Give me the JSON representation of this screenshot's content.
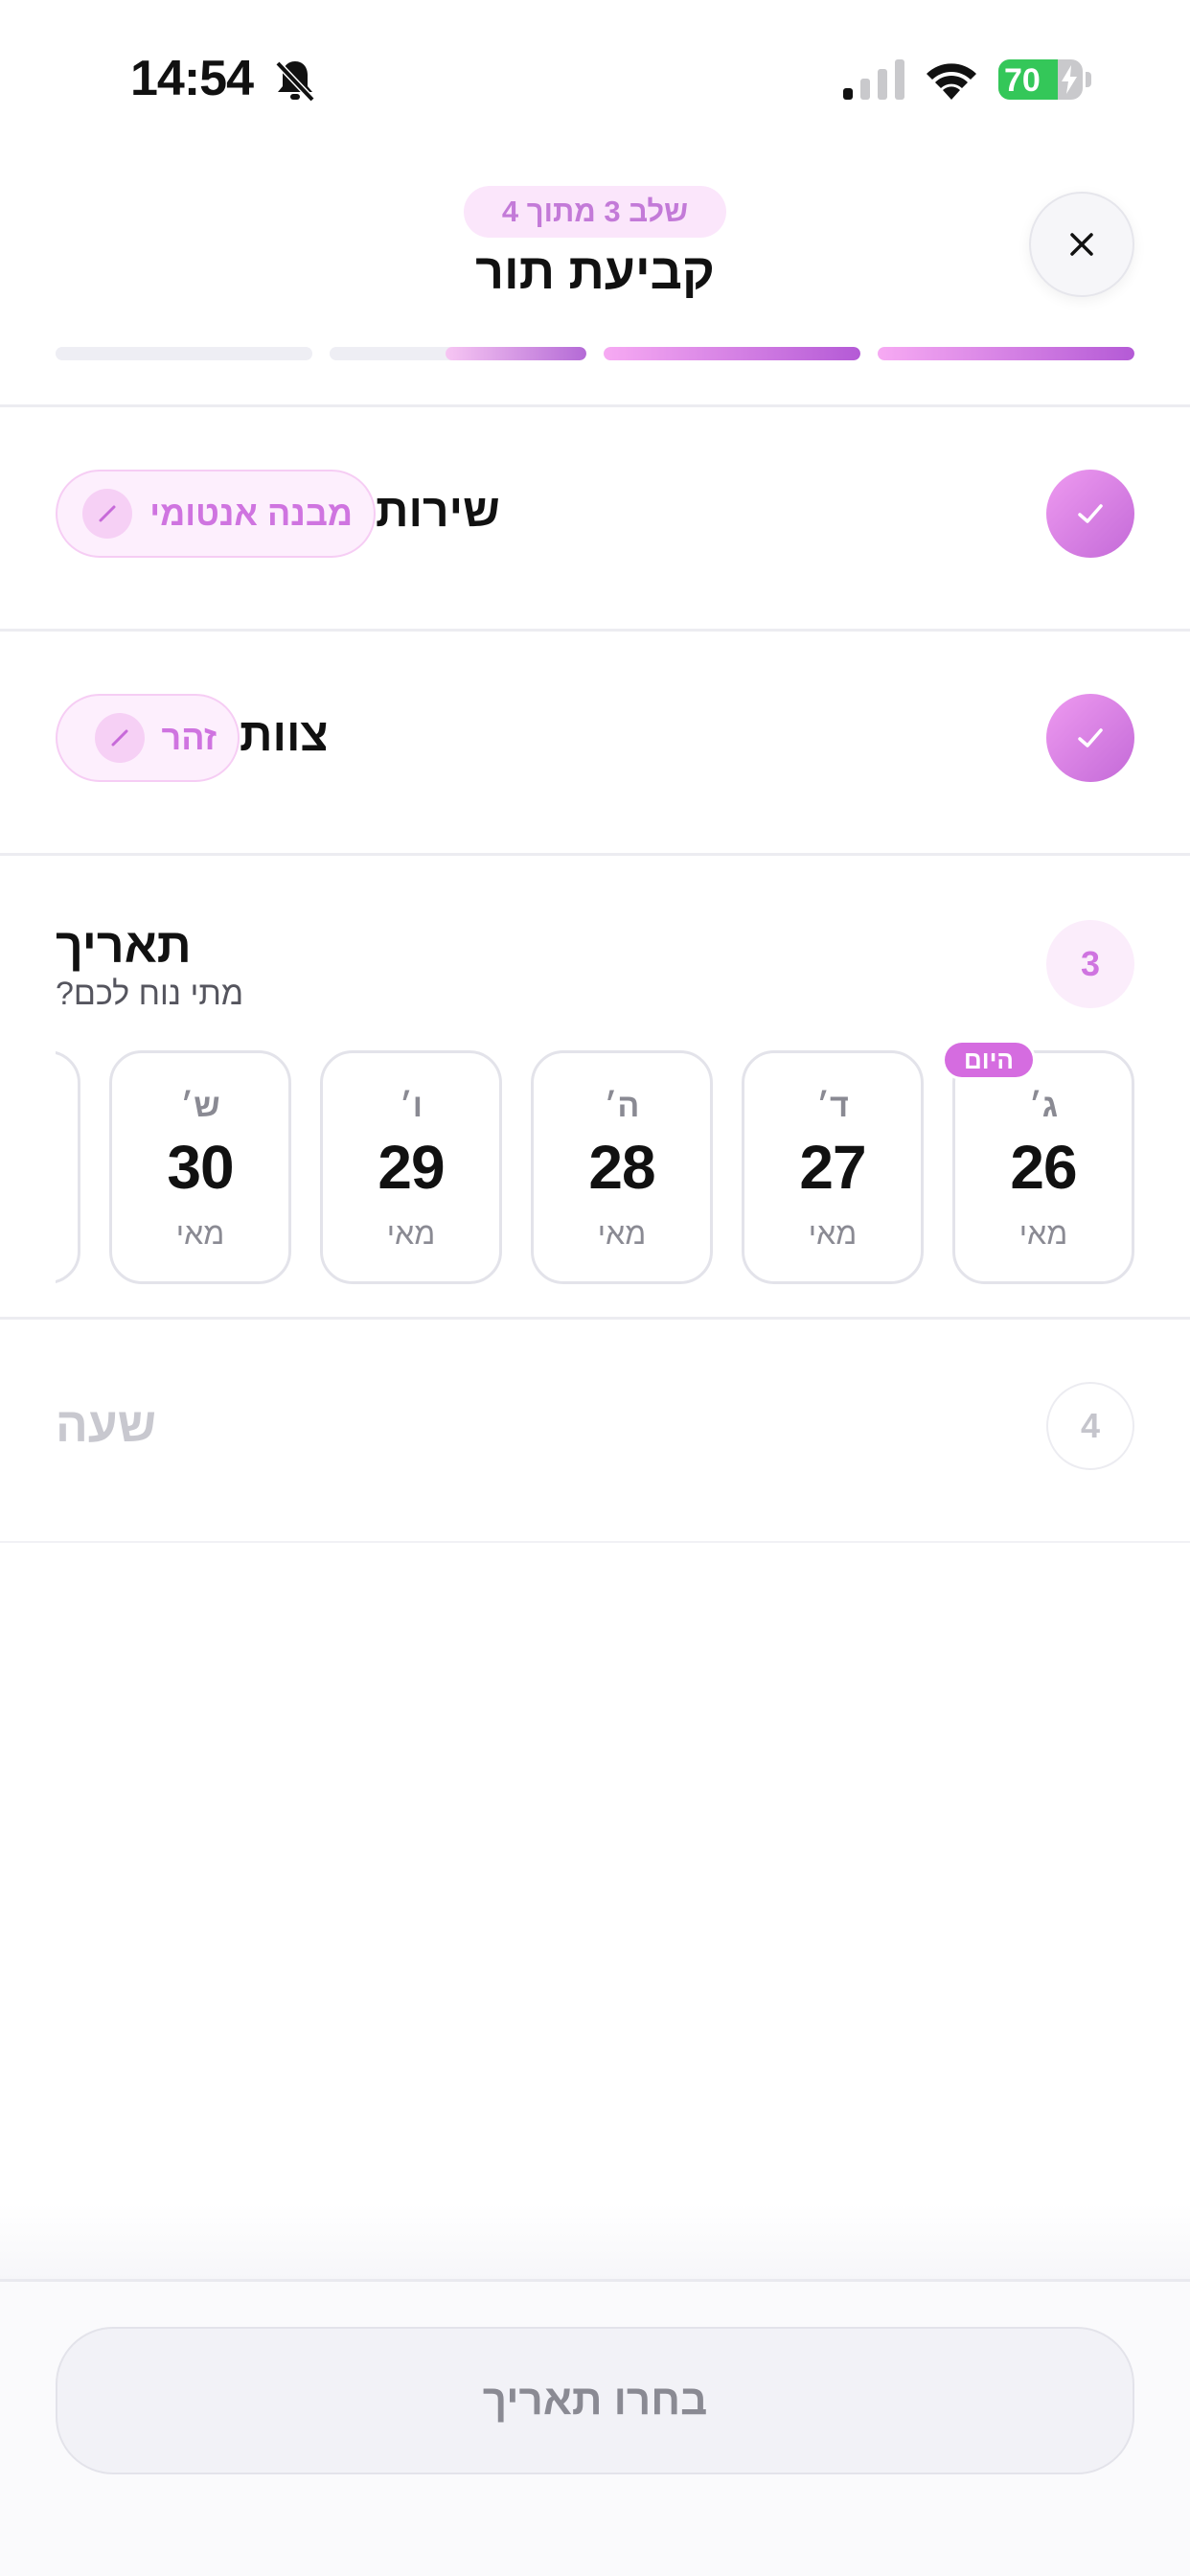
{
  "status_bar": {
    "time": "14:54",
    "battery_percent": 70,
    "battery_label": "70"
  },
  "header": {
    "step_indicator": "שלב 3 מתוך 4",
    "title": "קביעת תור",
    "close_label": "×"
  },
  "progress": [
    1,
    1,
    0.55,
    0
  ],
  "service": {
    "title": "שירות",
    "value": "מבנה אנטומי"
  },
  "team": {
    "title": "צוות",
    "value": "זהר"
  },
  "date_section": {
    "step_number": "3",
    "title": "תאריך",
    "subtitle": "מתי נוח לכם?",
    "today_label": "היום",
    "dates": [
      {
        "dow": "ג׳",
        "day": "26",
        "month": "מאי"
      },
      {
        "dow": "ד׳",
        "day": "27",
        "month": "מאי"
      },
      {
        "dow": "ה׳",
        "day": "28",
        "month": "מאי"
      },
      {
        "dow": "ו׳",
        "day": "29",
        "month": "מאי"
      },
      {
        "dow": "ש׳",
        "day": "30",
        "month": "מאי"
      }
    ]
  },
  "time_section": {
    "step_number": "4",
    "title": "שעה"
  },
  "footer": {
    "cta_label": "בחרו תאריך"
  },
  "colors": {
    "accent": "#cf74e0",
    "accent_dark": "#b45ad6",
    "success": "#34c759"
  }
}
